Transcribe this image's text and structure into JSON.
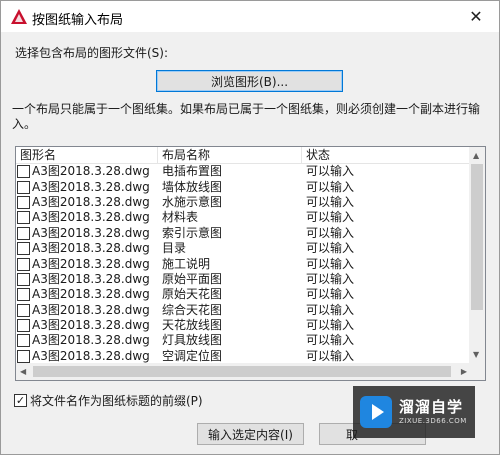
{
  "window": {
    "title": "按图纸输入布局",
    "close_glyph": "✕",
    "accent_color": "#c8102e"
  },
  "select_label": "选择包含布局的图形文件(S):",
  "browse_button": "浏览图形(B)...",
  "note": "一个布局只能属于一个图纸集。如果布局已属于一个图纸集，则必须创建一个副本进行输入。",
  "list": {
    "columns": [
      "图形名",
      "布局名称",
      "状态"
    ],
    "rows": [
      {
        "drawing": "A3图2018.3.28.dwg",
        "layout": "电插布置图",
        "status": "可以输入"
      },
      {
        "drawing": "A3图2018.3.28.dwg",
        "layout": "墙体放线图",
        "status": "可以输入"
      },
      {
        "drawing": "A3图2018.3.28.dwg",
        "layout": "水施示意图",
        "status": "可以输入"
      },
      {
        "drawing": "A3图2018.3.28.dwg",
        "layout": "材料表",
        "status": "可以输入"
      },
      {
        "drawing": "A3图2018.3.28.dwg",
        "layout": "索引示意图",
        "status": "可以输入"
      },
      {
        "drawing": "A3图2018.3.28.dwg",
        "layout": "目录",
        "status": "可以输入"
      },
      {
        "drawing": "A3图2018.3.28.dwg",
        "layout": "施工说明",
        "status": "可以输入"
      },
      {
        "drawing": "A3图2018.3.28.dwg",
        "layout": "原始平面图",
        "status": "可以输入"
      },
      {
        "drawing": "A3图2018.3.28.dwg",
        "layout": "原始天花图",
        "status": "可以输入"
      },
      {
        "drawing": "A3图2018.3.28.dwg",
        "layout": "综合天花图",
        "status": "可以输入"
      },
      {
        "drawing": "A3图2018.3.28.dwg",
        "layout": "天花放线图",
        "status": "可以输入"
      },
      {
        "drawing": "A3图2018.3.28.dwg",
        "layout": "灯具放线图",
        "status": "可以输入"
      },
      {
        "drawing": "A3图2018.3.28.dwg",
        "layout": "空调定位图",
        "status": "可以输入"
      }
    ]
  },
  "prefix_checkbox": {
    "label": "将文件名作为图纸标题的前缀(P)",
    "checked": true,
    "check_glyph": "✓"
  },
  "buttons": {
    "import": "输入选定内容(I)",
    "cancel": "取"
  },
  "watermark": {
    "main": "溜溜自学",
    "sub": "ZIXUE.3D66.COM"
  }
}
